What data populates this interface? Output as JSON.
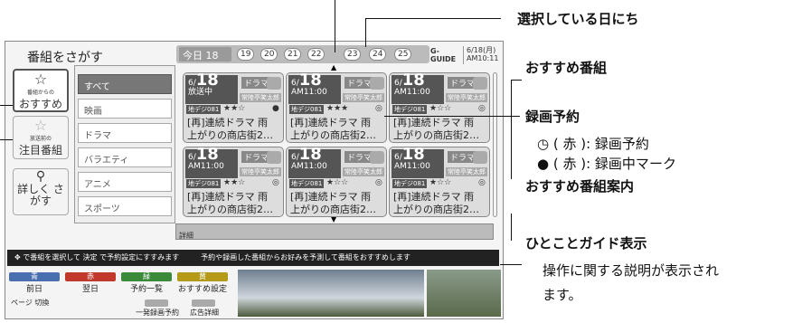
{
  "title": "番組をさがす",
  "today": "今日 18",
  "days": [
    "19",
    "20",
    "21",
    "22",
    "23",
    "24",
    "25"
  ],
  "logo": "G-GUIDE",
  "date": "6/18(月)",
  "time": "AM10:11",
  "nav": [
    {
      "top": "番組からの",
      "label": "おすすめ"
    },
    {
      "top": "放送前の",
      "label": "注目番組"
    },
    {
      "top": "",
      "label": "詳しく さがす"
    }
  ],
  "categories": [
    "すべて",
    "映画",
    "ドラマ",
    "バラエティ",
    "アニメ",
    "スポーツ"
  ],
  "cards": [
    {
      "day": "18",
      "month": "6/",
      "time": "放送中",
      "genre": "ドラマ",
      "actor": "常陸亭笑太郎",
      "ch": "地デジ081",
      "stars": "★★☆",
      "mark": "●",
      "line1": "[再]連続ドラマ 雨",
      "line2": "上がりの商店街2…"
    },
    {
      "day": "18",
      "month": "6/",
      "time": "AM11:00",
      "genre": "ドラマ",
      "actor": "常陸亭笑太郎",
      "ch": "地デジ081",
      "stars": "★★★",
      "mark": "◎",
      "line1": "[再]連続ドラマ 雨",
      "line2": "上がりの商店街2…"
    },
    {
      "day": "18",
      "month": "6/",
      "time": "AM11:00",
      "genre": "ドラマ",
      "actor": "常陸亭笑太郎",
      "ch": "地デジ081",
      "stars": "★☆☆",
      "mark": "◎",
      "line1": "[再]連続ドラマ 雨",
      "line2": "上がりの商店街2…"
    },
    {
      "day": "18",
      "month": "6/",
      "time": "AM11:00",
      "genre": "ドラマ",
      "actor": "常陸亭笑太郎",
      "ch": "地デジ081",
      "stars": "★★☆",
      "mark": "◎",
      "line1": "[再]連続ドラマ 雨",
      "line2": "上がりの商店街2…"
    },
    {
      "day": "18",
      "month": "6/",
      "time": "AM11:00",
      "genre": "ドラマ",
      "actor": "常陸亭笑太郎",
      "ch": "地デジ081",
      "stars": "★☆☆",
      "mark": "◎",
      "line1": "[再]連続ドラマ 雨",
      "line2": "上がりの商店街2…"
    },
    {
      "day": "18",
      "month": "6/",
      "time": "AM11:00",
      "genre": "ドラマ",
      "actor": "常陸亭笑太郎",
      "ch": "地デジ081",
      "stars": "★☆☆",
      "mark": "◎",
      "line1": "[再]連続ドラマ 雨",
      "line2": "上がりの商店街2…"
    }
  ],
  "detail": "詳細",
  "guide": "で番組を選択して 決定 で予約設定にすすみます　　　予約や録画した番組からお好みを予測して番組をおすすめします",
  "color_buttons": [
    {
      "color": "#4a6fb0",
      "name": "青",
      "label": "前日"
    },
    {
      "color": "#c0392b",
      "name": "赤",
      "label": "翌日"
    },
    {
      "color": "#3a8a3a",
      "name": "緑",
      "label": "予約一覧"
    },
    {
      "color": "#b59a1a",
      "name": "黄",
      "label": "おすすめ設定"
    }
  ],
  "page_label": "ページ 切換",
  "record_label": "一発録画予約",
  "ad_label": "広告詳細",
  "annotations": {
    "selected_day": "選択している日にち",
    "recommended": "おすすめ番組",
    "rec_reserve": "録画予約",
    "rec_red": "( 赤 ): 録画予約",
    "rec_dot": "( 赤 ): 録画中マーク",
    "guide_info": "おすすめ番組案内",
    "hint": "ひとことガイド表示",
    "hint_desc1": "操作に関する説明が表示され",
    "hint_desc2": "ます。"
  }
}
